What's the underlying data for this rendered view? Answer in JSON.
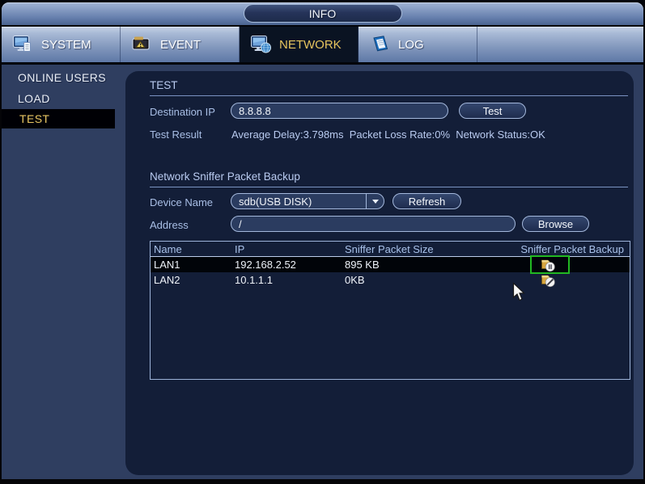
{
  "window": {
    "title": "INFO"
  },
  "tabs": [
    {
      "label": "SYSTEM",
      "active": false
    },
    {
      "label": "EVENT",
      "active": false
    },
    {
      "label": "NETWORK",
      "active": true
    },
    {
      "label": "LOG",
      "active": false
    }
  ],
  "sidebar": {
    "items": [
      {
        "label": "ONLINE USERS",
        "active": false
      },
      {
        "label": "LOAD",
        "active": false
      },
      {
        "label": "TEST",
        "active": true
      }
    ]
  },
  "test_section": {
    "title": "TEST",
    "destination_ip_label": "Destination IP",
    "destination_ip_value": "8.8.8.8",
    "test_button": "Test",
    "test_result_label": "Test Result",
    "test_result_value": "Average Delay:3.798ms  Packet Loss Rate:0%  Network Status:OK"
  },
  "sniffer_section": {
    "title": "Network Sniffer Packet Backup",
    "device_name_label": "Device Name",
    "device_name_value": "sdb(USB DISK)",
    "refresh_button": "Refresh",
    "address_label": "Address",
    "address_value": "/",
    "browse_button": "Browse"
  },
  "table": {
    "columns": [
      "Name",
      "IP",
      "Sniffer Packet Size",
      "Sniffer Packet Backup"
    ],
    "rows": [
      {
        "name": "LAN1",
        "ip": "192.168.2.52",
        "size": "895 KB",
        "backup_icon": "pause-capture-icon",
        "selected": true
      },
      {
        "name": "LAN2",
        "ip": "10.1.1.1",
        "size": "0KB",
        "backup_icon": "start-capture-icon",
        "selected": false
      }
    ]
  },
  "colors": {
    "active_tab_text": "#e6c35c",
    "selection_green": "#22b822",
    "panel_bg": "#131e38",
    "body_bg": "#2f3e60",
    "accent_border": "#a4b8dc"
  }
}
